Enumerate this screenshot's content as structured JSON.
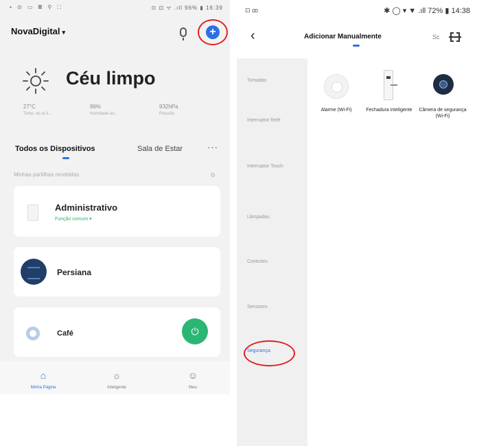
{
  "left": {
    "status_left_icons": "▪ ⊙ ▭ 𝄜 ⚲ ⛶",
    "status_right": "⊙ ⊡ ᯤ .ıll 96% ▮ 16:39",
    "home_name": "NovaDigital",
    "weather": {
      "condition": "Céu limpo",
      "stats": [
        {
          "value": "27°C",
          "label": "Temp. ao ar li..."
        },
        {
          "value": "96%",
          "label": "Humidade ao..."
        },
        {
          "value": "932hPa",
          "label": "Pressão"
        }
      ]
    },
    "tabs": {
      "all": "Todos os Dispositivos",
      "room": "Sala de Estar",
      "more": "···"
    },
    "shared_label": "Minhas partilhas recebidas",
    "devices": {
      "admin": {
        "name": "Administrativo",
        "sub": "Função comum ▾"
      },
      "persiana": {
        "name": "Persiana"
      },
      "cafe": {
        "name": "Café"
      }
    },
    "nav": {
      "home": "Minha Página",
      "smart": "Inteligente",
      "me": "Meu"
    }
  },
  "right": {
    "status_left": "⊡ ꝏ",
    "status_right": "✱ ◯ ▾ ▼ .ıll 72% ▮ 14:38",
    "title": "Adicionar Manualmente",
    "scan_label": "Sc",
    "categories": [
      "Tomadas",
      "Interruptor Relé",
      "Interruptor Touch",
      "Lâmpadas",
      "Controles",
      "Sensores",
      "Segurança"
    ],
    "active_category": "Segurança",
    "devices": [
      "Alarme (Wi-Fi)",
      "Fechadura inteligente",
      "Câmera de segurança (Wi-Fi)"
    ]
  },
  "colors": {
    "accent": "#2f6fe4",
    "highlight_ring": "#e02020",
    "power_green": "#2bb673"
  }
}
